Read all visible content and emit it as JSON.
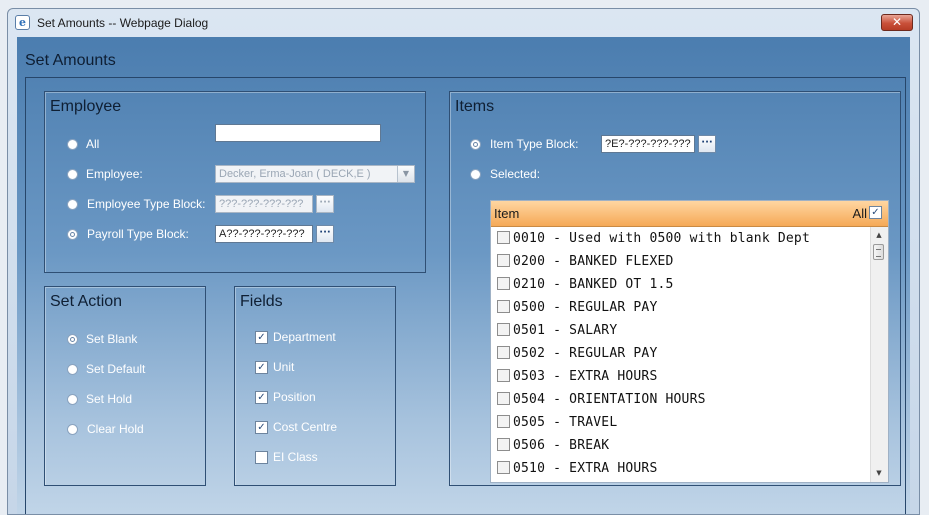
{
  "window": {
    "title": "Set Amounts -- Webpage Dialog",
    "close_label": "✕"
  },
  "dialog_title": "Set Amounts",
  "employee": {
    "heading": "Employee",
    "all_label": "All",
    "all_value": "",
    "employee_label": "Employee:",
    "employee_value": "Decker, Erma-Joan ( DECK,E )",
    "employee_type_block_label": "Employee Type Block:",
    "employee_type_block_value": "???-???-???-???",
    "payroll_type_block_label": "Payroll Type Block:",
    "payroll_type_block_value": "A??-???-???-???",
    "selected_option": "payroll_type_block"
  },
  "set_action": {
    "heading": "Set Action",
    "options": [
      "Set Blank",
      "Set Default",
      "Set Hold",
      "Clear Hold"
    ],
    "selected": "Set Blank"
  },
  "fields": {
    "heading": "Fields",
    "items": [
      {
        "label": "Department",
        "checked": true
      },
      {
        "label": "Unit",
        "checked": true
      },
      {
        "label": "Position",
        "checked": true
      },
      {
        "label": "Cost Centre",
        "checked": true
      },
      {
        "label": "EI Class",
        "checked": false
      }
    ]
  },
  "items": {
    "heading": "Items",
    "item_type_block_label": "Item Type Block:",
    "item_type_block_value": "?E?-???-???-???",
    "selected_label": "Selected:",
    "selected_option": "item_type_block",
    "grid": {
      "column_header": "Item",
      "all_label": "All",
      "all_checked": true,
      "rows": [
        "0010 - Used with 0500 with blank Dept",
        "0200 - BANKED FLEXED",
        "0210 - BANKED OT 1.5",
        "0500 - REGULAR PAY",
        "0501 - SALARY",
        "0502 - REGULAR PAY",
        "0503 - EXTRA HOURS",
        "0504 - ORIENTATION HOURS",
        "0505 - TRAVEL",
        "0506 - BREAK",
        "0510 - EXTRA HOURS"
      ]
    }
  },
  "icons": {
    "window_icon": "ie-page-icon",
    "close": "close-icon",
    "ellipsis": "ellipsis-icon",
    "dropdown": "chevron-down-icon"
  }
}
